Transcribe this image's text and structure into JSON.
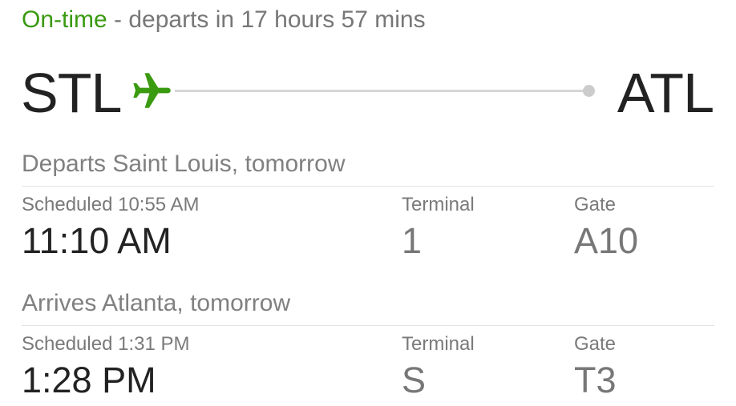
{
  "status": {
    "state": "On-time",
    "separator": " - ",
    "detail": "departs in 17 hours 57 mins",
    "state_color": "#3a9a10"
  },
  "route": {
    "origin_code": "STL",
    "destination_code": "ATL",
    "icon": "airplane-icon"
  },
  "departure": {
    "header": "Departs Saint Louis, tomorrow",
    "scheduled": "Scheduled 10:55 AM",
    "actual": "11:10 AM",
    "terminal_label": "Terminal",
    "terminal": "1",
    "gate_label": "Gate",
    "gate": "A10"
  },
  "arrival": {
    "header": "Arrives Atlanta, tomorrow",
    "scheduled": "Scheduled 1:31 PM",
    "actual": "1:28 PM",
    "terminal_label": "Terminal",
    "terminal": "S",
    "gate_label": "Gate",
    "gate": "T3"
  }
}
